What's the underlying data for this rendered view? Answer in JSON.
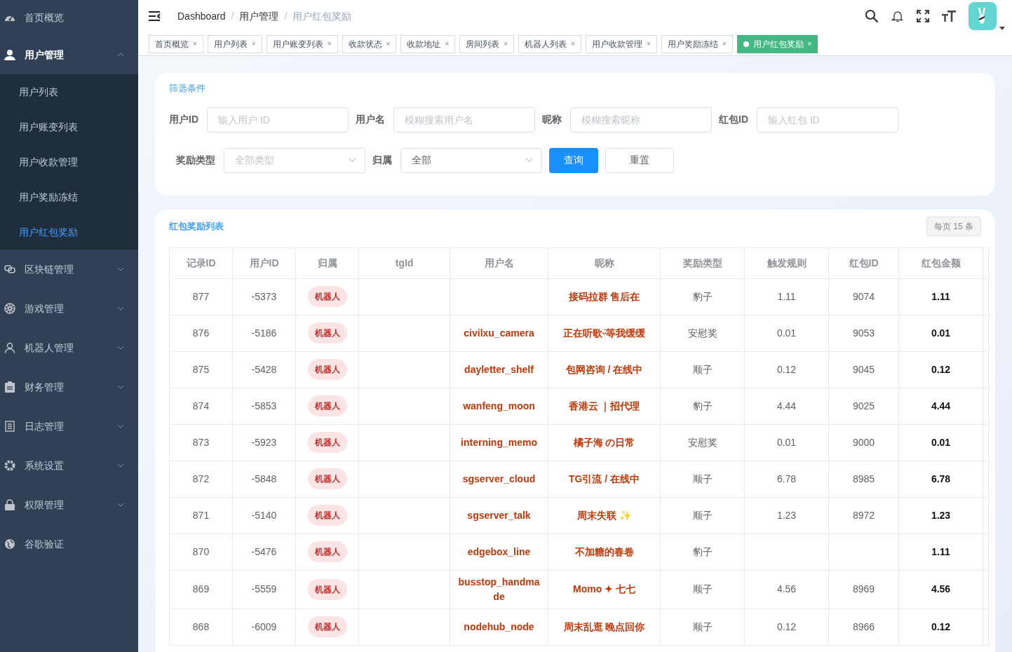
{
  "sidebar": {
    "items": [
      {
        "label": "首页概览",
        "kind": "link",
        "selected": false
      },
      {
        "label": "用户管理",
        "kind": "group",
        "expanded": true,
        "selected": false,
        "children": [
          {
            "label": "用户列表",
            "selected": false
          },
          {
            "label": "用户账变列表",
            "selected": false
          },
          {
            "label": "用户收款管理",
            "selected": false
          },
          {
            "label": "用户奖励冻结",
            "selected": false
          },
          {
            "label": "用户红包奖励",
            "selected": true
          }
        ]
      },
      {
        "label": "区块链管理",
        "kind": "group",
        "expanded": false,
        "selected": false
      },
      {
        "label": "游戏管理",
        "kind": "group",
        "expanded": false,
        "selected": false
      },
      {
        "label": "机器人管理",
        "kind": "group",
        "expanded": false,
        "selected": false
      },
      {
        "label": "财务管理",
        "kind": "group",
        "expanded": false,
        "selected": false
      },
      {
        "label": "日志管理",
        "kind": "group",
        "expanded": false,
        "selected": false
      },
      {
        "label": "系统设置",
        "kind": "group",
        "expanded": false,
        "selected": false
      },
      {
        "label": "权限管理",
        "kind": "group",
        "expanded": false,
        "selected": false
      },
      {
        "label": "谷歌验证",
        "kind": "link",
        "selected": false
      }
    ]
  },
  "breadcrumb": [
    {
      "kind": "link",
      "text": "Dashboard"
    },
    {
      "kind": "separator",
      "text": "/"
    },
    {
      "kind": "link",
      "text": "用户管理"
    },
    {
      "kind": "separator",
      "text": "/"
    },
    {
      "kind": "current",
      "text": "用户红包奖励"
    }
  ],
  "tags": [
    {
      "label": "首页概览",
      "close": "×",
      "selected": false
    },
    {
      "label": "用户列表",
      "close": "×",
      "selected": false
    },
    {
      "label": "用户账变列表",
      "close": "×",
      "selected": false
    },
    {
      "label": "收款状态",
      "close": "×",
      "selected": false
    },
    {
      "label": "收款地址",
      "close": "×",
      "selected": false
    },
    {
      "label": "房间列表",
      "close": "×",
      "selected": false
    },
    {
      "label": "机器人列表",
      "close": "×",
      "selected": false
    },
    {
      "label": "用户收款管理",
      "close": "×",
      "selected": false
    },
    {
      "label": "用户奖励冻结",
      "close": "×",
      "selected": false
    },
    {
      "label": "用户红包奖励",
      "close": "×",
      "selected": true
    }
  ],
  "filter": {
    "title": "筛选条件",
    "fields": [
      {
        "label": "用户ID",
        "kind": "input",
        "placeholder": "输入用户 ID"
      },
      {
        "label": "用户名",
        "kind": "input",
        "placeholder": "模糊搜索用户名"
      },
      {
        "label": "昵称",
        "kind": "input",
        "placeholder": "模糊搜索昵称"
      },
      {
        "label": "红包ID",
        "kind": "input",
        "placeholder": "输入红包 ID"
      },
      {
        "label": "奖励类型",
        "kind": "select",
        "placeholder": "全部类型"
      },
      {
        "label": "归属",
        "kind": "select",
        "value": "全部"
      }
    ],
    "buttons": [
      {
        "label": "查询",
        "kind": "primary"
      },
      {
        "label": "重置",
        "kind": "default"
      }
    ]
  },
  "table": {
    "title": "红包奖励列表",
    "page_size": "每页 15 条",
    "columns": [
      "记录ID",
      "用户ID",
      "归属",
      "tgId",
      "用户名",
      "昵称",
      "奖励类型",
      "触发规则",
      "红包ID",
      "红包金额"
    ],
    "rows": [
      {
        "id": "877",
        "user_id": "-5373",
        "owner": "机器人",
        "nickname": "接码拉群 售后在",
        "reward_type": "豹子",
        "rule": "1.11",
        "packet_id": "9074",
        "amount": "1.11"
      },
      {
        "id": "876",
        "user_id": "-5186",
        "owner": "机器人",
        "username": "civilxu_camera",
        "nickname": "正在听歌ᵕ̈等我缓缓",
        "reward_type": "安慰奖",
        "rule": "0.01",
        "packet_id": "9053",
        "amount": "0.01"
      },
      {
        "id": "875",
        "user_id": "-5428",
        "owner": "机器人",
        "username": "dayletter_shelf",
        "nickname": "包网咨询 / 在线中",
        "reward_type": "顺子",
        "rule": "0.12",
        "packet_id": "9045",
        "amount": "0.12"
      },
      {
        "id": "874",
        "user_id": "-5853",
        "owner": "机器人",
        "username": "wanfeng_moon",
        "nickname": "香港云 ｜招代理",
        "reward_type": "豹子",
        "rule": "4.44",
        "packet_id": "9025",
        "amount": "4.44"
      },
      {
        "id": "873",
        "user_id": "-5923",
        "owner": "机器人",
        "username": "interning_memo",
        "nickname": "橘子海 の日常",
        "reward_type": "安慰奖",
        "rule": "0.01",
        "packet_id": "9000",
        "amount": "0.01"
      },
      {
        "id": "872",
        "user_id": "-5848",
        "owner": "机器人",
        "username": "sgserver_cloud",
        "nickname": "TG引流 / 在线中",
        "reward_type": "顺子",
        "rule": "6.78",
        "packet_id": "8985",
        "amount": "6.78"
      },
      {
        "id": "871",
        "user_id": "-5140",
        "owner": "机器人",
        "username": "sgserver_talk",
        "nickname": "周末失联 ✨",
        "reward_type": "顺子",
        "rule": "1.23",
        "packet_id": "8972",
        "amount": "1.23"
      },
      {
        "id": "870",
        "user_id": "-5476",
        "owner": "机器人",
        "username": "edgebox_line",
        "nickname": "不加糖的春卷",
        "reward_type": "豹子",
        "amount": "1.11"
      },
      {
        "id": "869",
        "user_id": "-5559",
        "owner": "机器人",
        "username": "busstop_handmade",
        "nickname": "Momo ✦ 七七",
        "reward_type": "顺子",
        "rule": "4.56",
        "packet_id": "8969",
        "amount": "4.56"
      },
      {
        "id": "868",
        "user_id": "-6009",
        "owner": "机器人",
        "username": "nodehub_node",
        "nickname": "周末乱逛 晚点回你",
        "reward_type": "顺子",
        "rule": "0.12",
        "packet_id": "8966",
        "amount": "0.12"
      }
    ]
  }
}
